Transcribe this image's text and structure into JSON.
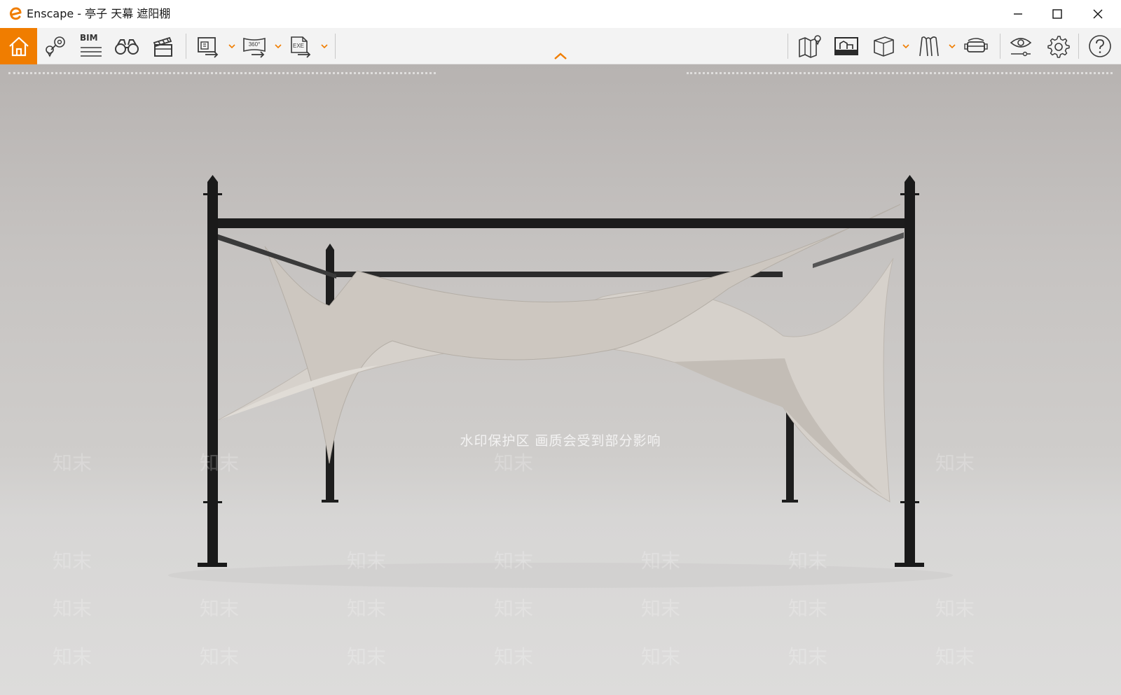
{
  "window": {
    "title": "Enscape - 亭子 天幕 遮阳棚",
    "controls": [
      "minimize",
      "maximize",
      "close"
    ]
  },
  "colors": {
    "accent": "#f07d00",
    "toolbar_bg": "#f3f3f3",
    "icon_stroke": "#3a3a3a"
  },
  "toolbar": {
    "left_icons": [
      "home-icon",
      "location-pins-icon",
      "bim-icon",
      "binoculars-icon",
      "clapperboard-icon",
      "batch-render-icon",
      "panorama-360-icon",
      "exe-export-icon"
    ],
    "bim_label": "BIM",
    "panorama_label": "360°",
    "exe_label": "EXE",
    "right_icons": [
      "map-icon",
      "render-view-icon",
      "cube-icon",
      "material-icon",
      "vr-headset-icon",
      "visual-settings-icon",
      "gear-icon",
      "help-icon"
    ],
    "collapse_icon": "chevron-up-icon"
  },
  "viewport": {
    "watermark_banner": "水印保护区   画质会受到部分影响",
    "watermark_tile": "知末"
  }
}
